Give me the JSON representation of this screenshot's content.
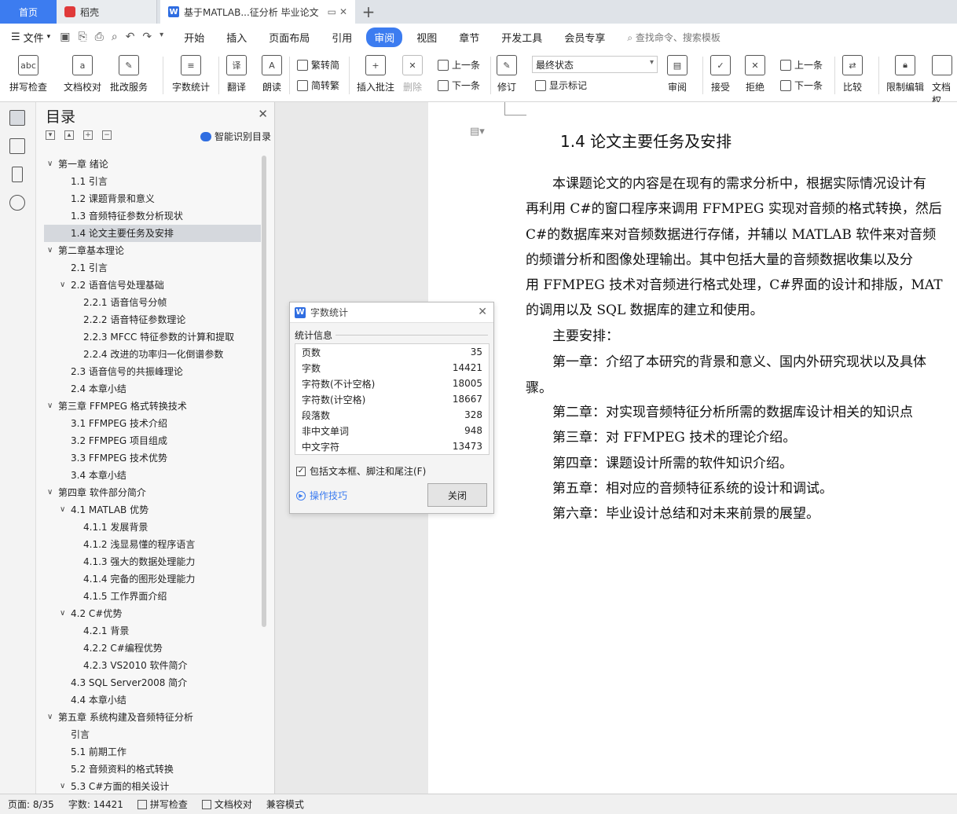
{
  "tabs": {
    "home": "首页",
    "daoke": "稻壳",
    "doc_title": "基于MATLAB...征分析 毕业论文"
  },
  "menu": {
    "file": "文件",
    "tabs": [
      "开始",
      "插入",
      "页面布局",
      "引用",
      "审阅",
      "视图",
      "章节",
      "开发工具",
      "会员专享"
    ],
    "active_tab": "审阅",
    "search": "查找命令、搜索模板"
  },
  "ribbon": {
    "spellcheck": "拼写检查",
    "doc_proof": "文档校对",
    "batch_service": "批改服务",
    "word_count": "字数统计",
    "translate": "翻译",
    "read_aloud": "朗读",
    "trad_convert": "繁转简",
    "simp_convert": "简转繁",
    "insert_comment": "插入批注",
    "delete": "删除",
    "prev_comment": "上一条",
    "next_comment": "下一条",
    "revise": "修订",
    "final_state": "最终状态",
    "show_marks": "显示标记",
    "review": "审阅",
    "accept": "接受",
    "reject": "拒绝",
    "prev_change": "上一条",
    "next_change": "下一条",
    "compare": "比较",
    "restrict_edit": "限制编辑",
    "doc_perm": "文档权"
  },
  "toc": {
    "title": "目录",
    "smart": "智能识别目录",
    "items": [
      {
        "label": "第一章  绪论",
        "level": 1,
        "caret": true
      },
      {
        "label": "1.1  引言",
        "level": 2
      },
      {
        "label": "1.2 课题背景和意义",
        "level": 2
      },
      {
        "label": "1.3  音频特征参数分析现状",
        "level": 2
      },
      {
        "label": "1.4 论文主要任务及安排",
        "level": 2,
        "selected": true
      },
      {
        "label": "第二章基本理论",
        "level": 1,
        "caret": true
      },
      {
        "label": "2.1  引言",
        "level": 2
      },
      {
        "label": "2.2  语音信号处理基础",
        "level": 2,
        "caret": true
      },
      {
        "label": "2.2.1 语音信号分帧",
        "level": 3
      },
      {
        "label": "2.2.2 语音特征参数理论",
        "level": 3
      },
      {
        "label": "2.2.3 MFCC 特征参数的计算和提取",
        "level": 3
      },
      {
        "label": "2.2.4 改进的功率归一化倒谱参数",
        "level": 3
      },
      {
        "label": "2.3 语音信号的共振峰理论",
        "level": 2
      },
      {
        "label": "2.4 本章小结",
        "level": 2
      },
      {
        "label": "第三章  FFMPEG 格式转换技术",
        "level": 1,
        "caret": true
      },
      {
        "label": "3.1 FFMPEG 技术介绍",
        "level": 2
      },
      {
        "label": "3.2 FFMPEG 项目组成",
        "level": 2
      },
      {
        "label": "3.3 FFMPEG 技术优势",
        "level": 2
      },
      {
        "label": "3.4 本章小结",
        "level": 2
      },
      {
        "label": "第四章  软件部分简介",
        "level": 1,
        "caret": true
      },
      {
        "label": "4.1 MATLAB 优势",
        "level": 2,
        "caret": true
      },
      {
        "label": "4.1.1 发展背景",
        "level": 3
      },
      {
        "label": "4.1.2  浅显易懂的程序语言",
        "level": 3
      },
      {
        "label": "4.1.3  强大的数据处理能力",
        "level": 3
      },
      {
        "label": "4.1.4  完备的图形处理能力",
        "level": 3
      },
      {
        "label": "4.1.5  工作界面介绍",
        "level": 3
      },
      {
        "label": "4.2 C#优势",
        "level": 2,
        "caret": true
      },
      {
        "label": "4.2.1 背景",
        "level": 3
      },
      {
        "label": "4.2.2 C#编程优势",
        "level": 3
      },
      {
        "label": "4.2.3 VS2010 软件简介",
        "level": 3
      },
      {
        "label": "4.3 SQL Server2008 简介",
        "level": 2
      },
      {
        "label": "4.4  本章小结",
        "level": 2
      },
      {
        "label": "第五章  系统构建及音频特征分析",
        "level": 1,
        "caret": true
      },
      {
        "label": "引言",
        "level": 2
      },
      {
        "label": "5.1  前期工作",
        "level": 2
      },
      {
        "label": "5.2  音频资料的格式转换",
        "level": 2
      },
      {
        "label": "5.3 C#方面的相关设计",
        "level": 2,
        "caret": true
      }
    ]
  },
  "document": {
    "heading": "1.4 论文主要任务及安排",
    "lines": [
      "　　本课题论文的内容是在现有的需求分析中，根据实际情况设计有",
      "再利用 C#的窗口程序来调用 FFMPEG 实现对音频的格式转换，然后",
      "C#的数据库来对音频数据进行存储，并辅以 MATLAB 软件来对音频",
      "的频谱分析和图像处理输出。其中包括大量的音频数据收集以及分",
      "用 FFMPEG 技术对音频进行格式处理，C#界面的设计和排版，MAT",
      "的调用以及 SQL 数据库的建立和使用。",
      "　　主要安排：",
      "　　第一章：介绍了本研究的背景和意义、国内外研究现状以及具体",
      "骤。",
      "　　第二章：对实现音频特征分析所需的数据库设计相关的知识点",
      "　　第三章：对 FFMPEG 技术的理论介绍。",
      "　　第四章：课题设计所需的软件知识介绍。",
      "　　第五章：相对应的音频特征系统的设计和调试。",
      "　　第六章：毕业设计总结和对未来前景的展望。"
    ]
  },
  "dialog": {
    "title": "字数统计",
    "section": "统计信息",
    "rows": [
      {
        "label": "页数",
        "value": "35"
      },
      {
        "label": "字数",
        "value": "14421"
      },
      {
        "label": "字符数(不计空格)",
        "value": "18005"
      },
      {
        "label": "字符数(计空格)",
        "value": "18667"
      },
      {
        "label": "段落数",
        "value": "328"
      },
      {
        "label": "非中文单词",
        "value": "948"
      },
      {
        "label": "中文字符",
        "value": "13473"
      }
    ],
    "checkbox": "包括文本框、脚注和尾注(F)",
    "tips": "操作技巧",
    "close": "关闭"
  },
  "status": {
    "page": "页面: 8/35",
    "words": "字数: 14421",
    "spell": "拼写检查",
    "proof": "文档校对",
    "compat": "兼容模式"
  },
  "colors": {
    "accent": "#3c7cf0",
    "selection": "#d5d8dd"
  }
}
